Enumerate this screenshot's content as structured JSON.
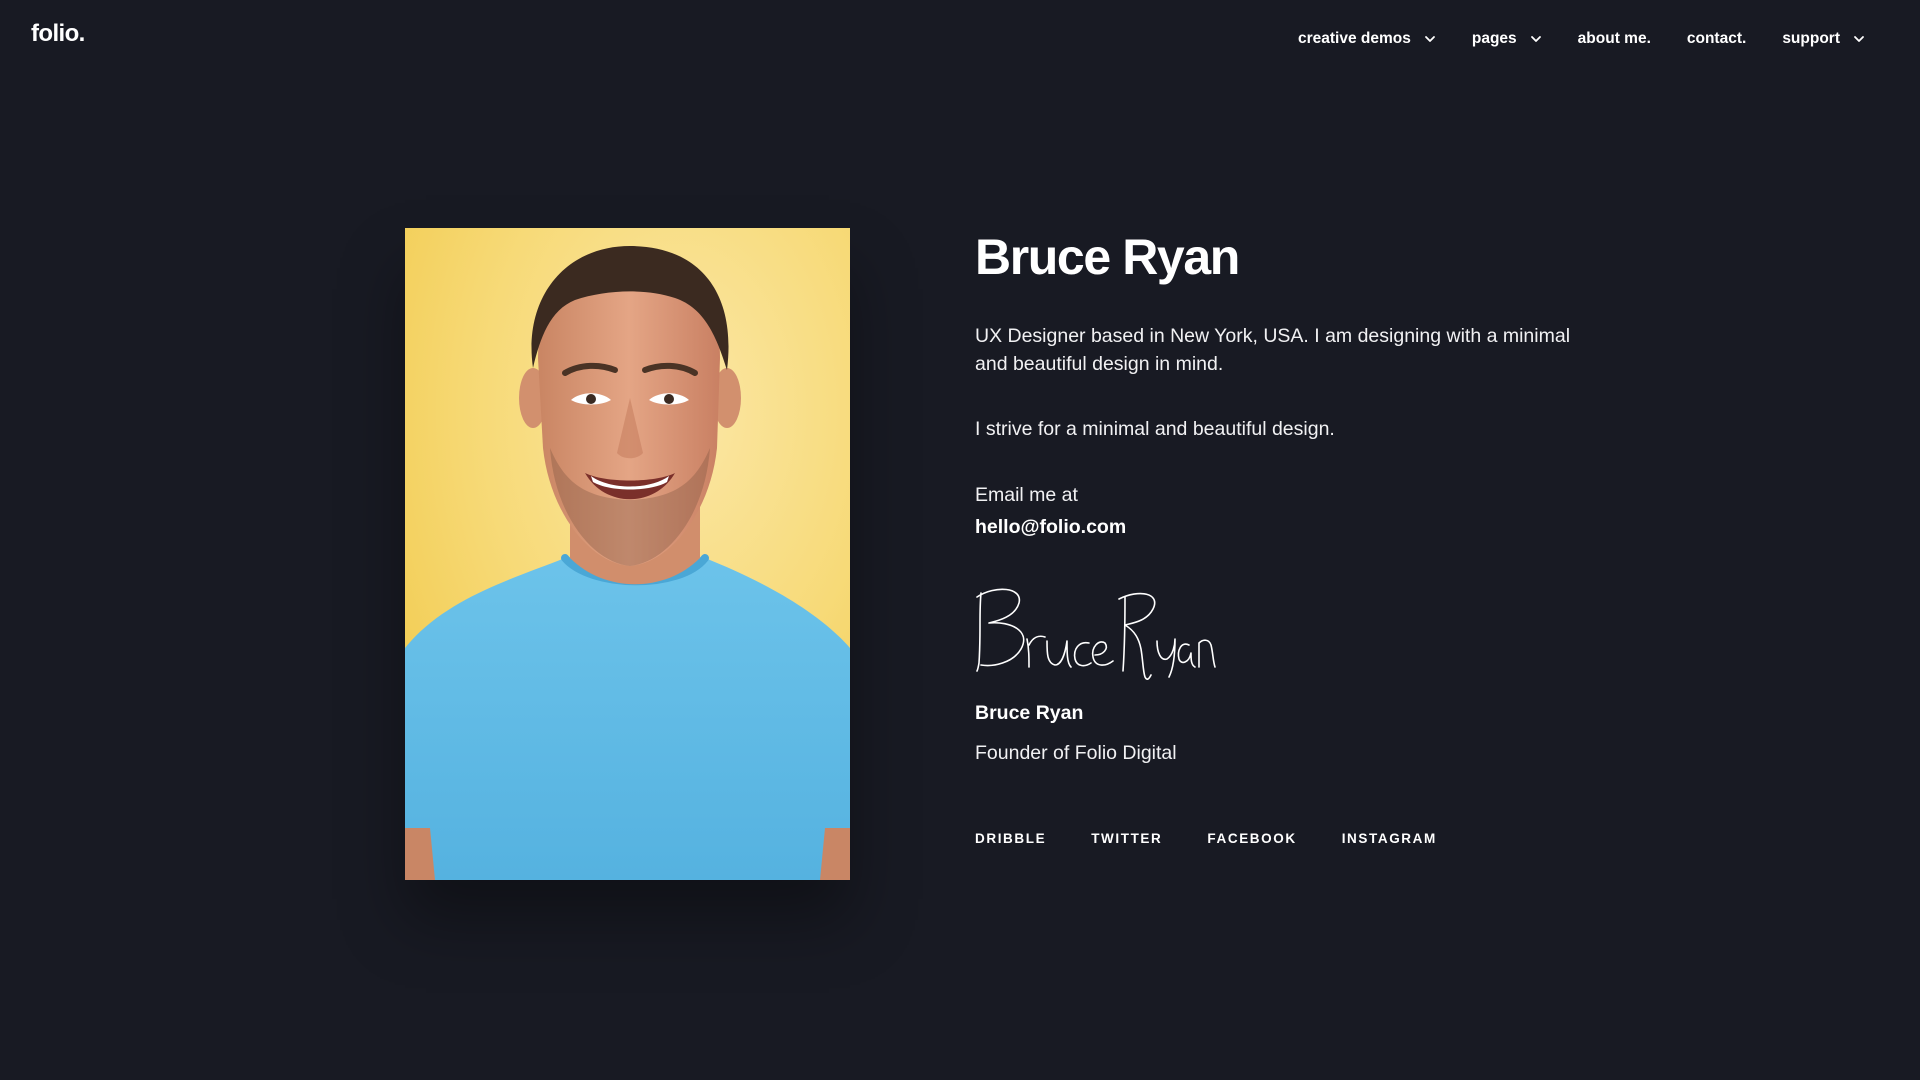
{
  "header": {
    "logo": "folio.",
    "nav": [
      {
        "label": "creative demos",
        "has_dropdown": true
      },
      {
        "label": "pages",
        "has_dropdown": true
      },
      {
        "label": "about me.",
        "has_dropdown": false
      },
      {
        "label": "contact.",
        "has_dropdown": false
      },
      {
        "label": "support",
        "has_dropdown": true
      }
    ]
  },
  "profile": {
    "name": "Bruce Ryan",
    "intro": "UX Designer based in New York, USA. I am designing with a minimal and beautiful design in mind.",
    "tagline": "I strive for a minimal and beautiful design.",
    "email_label": "Email me at",
    "email": "hello@folio.com",
    "signature_text": "Bruce Ryan",
    "signature_name": "Bruce Ryan",
    "signature_role": "Founder of Folio Digital"
  },
  "social": [
    {
      "label": "DRIBBLE"
    },
    {
      "label": "TWITTER"
    },
    {
      "label": "FACEBOOK"
    },
    {
      "label": "INSTAGRAM"
    }
  ],
  "colors": {
    "background": "#181a23",
    "text": "#ffffff",
    "portrait_background": "#f5d66c",
    "shirt": "#5dbbe7"
  },
  "icons": {
    "dropdown": "chevron-down-icon"
  }
}
